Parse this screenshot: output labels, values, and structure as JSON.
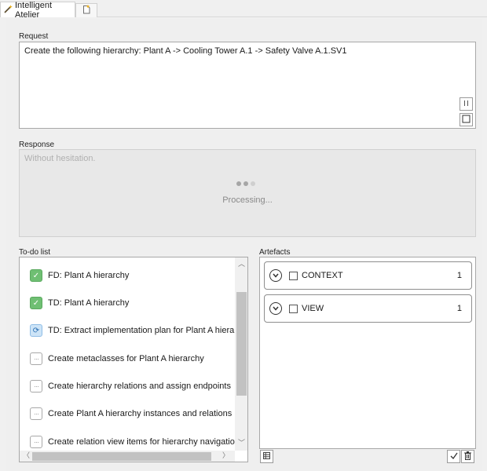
{
  "tab": {
    "title": "Intelligent Atelier"
  },
  "request": {
    "label": "Request",
    "text": "Create the following hierarchy: Plant A -> Cooling Tower A.1 -> Safety Valve A.1.SV1"
  },
  "response": {
    "label": "Response",
    "placeholder": "Without hesitation.",
    "status": "Processing...",
    "colors": {
      "dot_dark": "#a6a6a6",
      "dot_light": "#cfcfcf"
    }
  },
  "todo": {
    "label": "To-do list",
    "items": [
      {
        "text": "FD: Plant A hierarchy",
        "status": "done"
      },
      {
        "text": "TD: Plant A hierarchy",
        "status": "done"
      },
      {
        "text": "TD: Extract implementation plan for Plant A hierarchy",
        "status": "in-progress"
      },
      {
        "text": "Create metaclasses for Plant A hierarchy",
        "status": "pending"
      },
      {
        "text": "Create hierarchy relations and assign endpoints",
        "status": "pending"
      },
      {
        "text": "Create Plant A hierarchy instances and relations",
        "status": "pending"
      },
      {
        "text": "Create relation view items for hierarchy navigation",
        "status": "pending"
      }
    ]
  },
  "artefacts": {
    "label": "Artefacts",
    "items": [
      {
        "name": "CONTEXT",
        "count": "1"
      },
      {
        "name": "VIEW",
        "count": "1"
      }
    ]
  },
  "icons": {
    "tab": "wand-icon",
    "new_tab": "new-document-icon",
    "pause": "pause-icon",
    "stop": "stop-icon",
    "done": "check-icon",
    "in_progress": "refresh-icon",
    "pending": "ellipsis-icon",
    "expand": "chevron-down-icon",
    "grid": "grid-icon",
    "accept": "check-icon",
    "delete": "trash-icon"
  }
}
